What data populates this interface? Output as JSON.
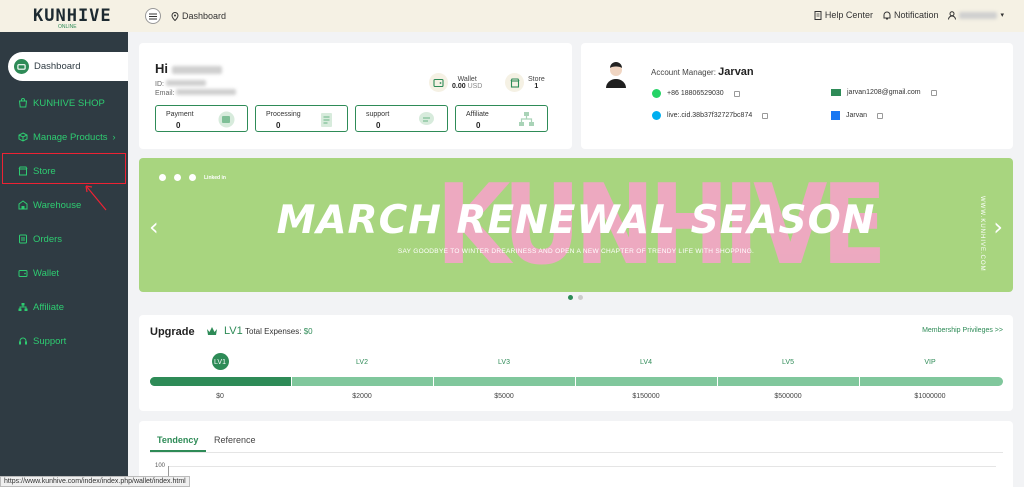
{
  "logo": {
    "text": "KUNHIVE",
    "sub": "ONLINE"
  },
  "sidebar": {
    "items": [
      {
        "label": "Dashboard"
      },
      {
        "label": "KUNHIVE SHOP"
      },
      {
        "label": "Manage Products"
      },
      {
        "label": "Store"
      },
      {
        "label": "Warehouse"
      },
      {
        "label": "Orders"
      },
      {
        "label": "Wallet"
      },
      {
        "label": "Affiliate"
      },
      {
        "label": "Support"
      }
    ]
  },
  "topbar": {
    "breadcrumb": "Dashboard",
    "help_center": "Help Center",
    "notification": "Notification"
  },
  "profile": {
    "greeting": "Hi",
    "id_label": "ID:",
    "email_label": "Email:",
    "wallet_label": "Wallet",
    "wallet_value": "0.00",
    "wallet_unit": "USD",
    "store_label": "Store",
    "store_value": "1",
    "boxes": [
      {
        "label": "Payment",
        "value": "0"
      },
      {
        "label": "Processing",
        "value": "0"
      },
      {
        "label": "support",
        "value": "0"
      },
      {
        "label": "Affiliate",
        "value": "0"
      }
    ]
  },
  "account_manager": {
    "label": "Account Manager:",
    "name": "Jarvan",
    "phone": "+86 18806529030",
    "email": "jarvan1208@gmail.com",
    "skype": "live:.cid.38b37f32727bc874",
    "facebook": "Jarvan"
  },
  "banner": {
    "ghost": "KUNHIVE",
    "headline": "MARCH RENEWAL SEASON",
    "subline": "SAY GOODBYE TO WINTER DREARINESS AND OPEN A NEW CHAPTER OF TRENDY LIFE WITH SHOPPING.",
    "site": "WWW.KUNHIVE.COM",
    "linkedin": "Linked in",
    "prev": "‹",
    "next": "›"
  },
  "upgrade": {
    "title": "Upgrade",
    "level": "LV1",
    "expenses_label": "Total Expenses:",
    "expenses_value": "$0",
    "privileges_link": "Membership Privileges >>",
    "levels": [
      "LV1",
      "LV2",
      "LV3",
      "LV4",
      "LV5",
      "VIP"
    ],
    "amounts": [
      "$0",
      "$2000",
      "$5000",
      "$150000",
      "$500000",
      "$1000000"
    ],
    "progress_fraction": 0.165
  },
  "tendency": {
    "tabs": [
      "Tendency",
      "Reference"
    ],
    "y_tick": "100"
  },
  "status_url": "https://www.kunhive.com/index/index.php/wallet/index.html",
  "colors": {
    "accent": "#2e8b57",
    "sidebar": "#2f3b43",
    "header": "#f5f1e4",
    "banner": "#a8d57f"
  }
}
